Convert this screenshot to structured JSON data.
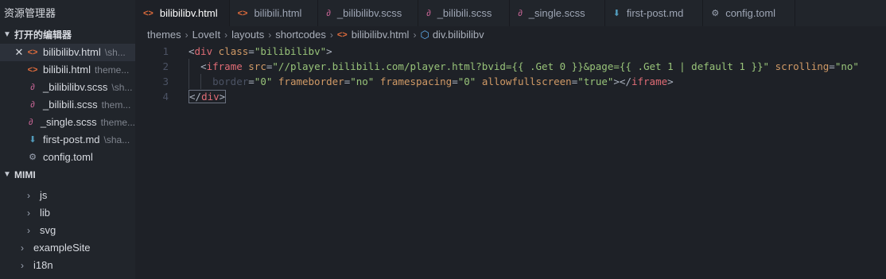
{
  "sidebar": {
    "title": "资源管理器",
    "open_editors_label": "打开的编辑器",
    "open_editors": [
      {
        "close": "✕",
        "name": "bilibilibv.html",
        "path": "\\sh...",
        "icon": "html-icon",
        "icon_glyph": "<>"
      },
      {
        "name": "bilibili.html",
        "path": "theme...",
        "icon": "html-icon",
        "icon_glyph": "<>"
      },
      {
        "name": "_bilibilibv.scss",
        "path": "\\sh...",
        "icon": "scss-icon",
        "icon_glyph": "∂"
      },
      {
        "name": "_bilibili.scss",
        "path": "them...",
        "icon": "scss-icon",
        "icon_glyph": "∂"
      },
      {
        "name": "_single.scss",
        "path": "theme...",
        "icon": "scss-icon",
        "icon_glyph": "∂"
      },
      {
        "name": "first-post.md",
        "path": "\\sha...",
        "icon": "markdown-icon",
        "icon_glyph": "⬇"
      },
      {
        "name": "config.toml",
        "path": "",
        "icon": "gear-icon",
        "icon_glyph": "⚙"
      }
    ],
    "project_label": "MIMI",
    "tree": [
      {
        "name": "js",
        "indent": 1
      },
      {
        "name": "lib",
        "indent": 1
      },
      {
        "name": "svg",
        "indent": 1
      },
      {
        "name": "exampleSite",
        "indent": 0
      },
      {
        "name": "i18n",
        "indent": 0
      }
    ]
  },
  "tabs": [
    {
      "label": "bilibilibv.html",
      "icon": "html-icon",
      "icon_glyph": "<>",
      "active": true
    },
    {
      "label": "bilibili.html",
      "icon": "html-icon",
      "icon_glyph": "<>"
    },
    {
      "label": "_bilibilibv.scss",
      "icon": "scss-icon",
      "icon_glyph": "∂"
    },
    {
      "label": "_bilibili.scss",
      "icon": "scss-icon",
      "icon_glyph": "∂"
    },
    {
      "label": "_single.scss",
      "icon": "scss-icon",
      "icon_glyph": "∂"
    },
    {
      "label": "first-post.md",
      "icon": "markdown-icon",
      "icon_glyph": "⬇"
    },
    {
      "label": "config.toml",
      "icon": "gear-icon",
      "icon_glyph": "⚙"
    }
  ],
  "breadcrumb": {
    "items": [
      "themes",
      "LoveIt",
      "layouts",
      "shortcodes"
    ],
    "file": "bilibilibv.html",
    "symbol": "div.bilibilibv",
    "separator": "›"
  },
  "editor": {
    "line_numbers": [
      "1",
      "2",
      "3",
      "4"
    ],
    "line1": {
      "open": "<",
      "tag": "div",
      "attr": "class",
      "eq": "=",
      "val": "\"bilibilibv\"",
      "close": ">"
    },
    "line2": {
      "open": "<",
      "tag": "iframe",
      "attr1": "src",
      "eq": "=",
      "val1": "\"//player.bilibili.com/player.html?bvid={{ .Get 0 }}&page={{ .Get 1 | default 1 }}\"",
      "attr2": "scrolling",
      "val2": "\"no\""
    },
    "line3": {
      "attr1": "border",
      "val1": "\"0\"",
      "attr2": "frameborder",
      "val2": "\"no\"",
      "attr3": "framespacing",
      "val3": "\"0\"",
      "attr4": "allowfullscreen",
      "val4": "\"true\"",
      "tail_open": "></",
      "tag": "iframe",
      "tail_close": ">"
    },
    "line4": {
      "open": "</",
      "tag": "div",
      "close": ">"
    }
  }
}
